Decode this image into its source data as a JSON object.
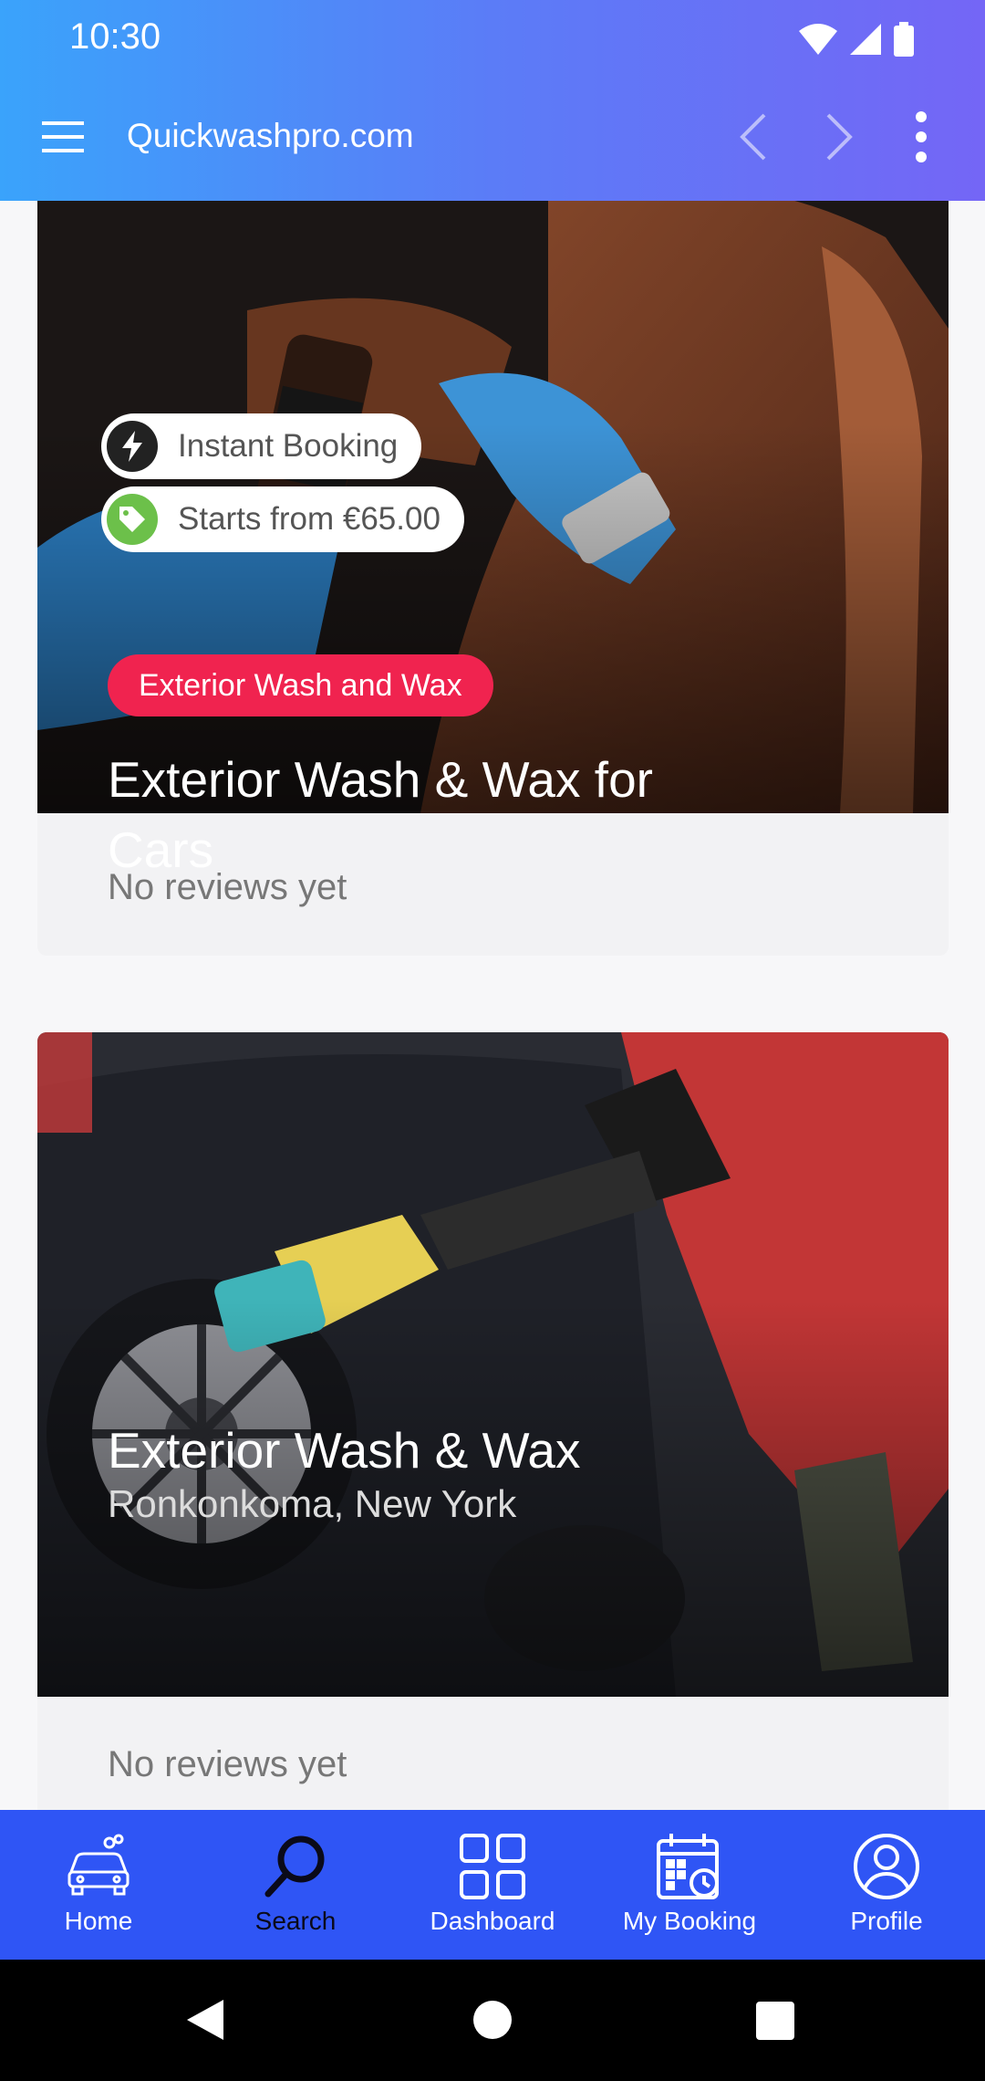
{
  "status_bar": {
    "time": "10:30"
  },
  "app_bar": {
    "title": "Quickwashpro.com"
  },
  "cards": [
    {
      "badges": {
        "booking": "Instant Booking",
        "price": "Starts from €65.00"
      },
      "category": "Exterior Wash and Wax",
      "title": "Exterior Wash & Wax for Cars",
      "reviews": "No reviews yet"
    },
    {
      "title": "Exterior Wash & Wax",
      "location": "Ronkonkoma, New York",
      "reviews": "No reviews yet"
    }
  ],
  "bottom_nav": [
    {
      "label": "Home",
      "icon": "car-icon",
      "active": false
    },
    {
      "label": "Search",
      "icon": "search-icon",
      "active": true
    },
    {
      "label": "Dashboard",
      "icon": "grid-icon",
      "active": false
    },
    {
      "label": "My Booking",
      "icon": "calendar-clock-icon",
      "active": false
    },
    {
      "label": "Profile",
      "icon": "user-circle-icon",
      "active": false
    }
  ],
  "colors": {
    "header_start": "#3aa3fb",
    "header_end": "#7466f6",
    "nav_bg": "#2f55f5",
    "category_tag": "#f0234f",
    "price_icon": "#6cc04a"
  }
}
